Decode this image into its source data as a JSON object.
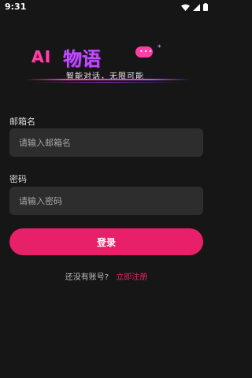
{
  "status_bar": {
    "time": "9:31"
  },
  "logo": {
    "ai_text": "AI",
    "name_text": "物语",
    "bubble_dots": "•••",
    "star": "*",
    "slogan": "智能对话，无限可能",
    "colors": {
      "pink": "#ff3fa6",
      "purple": "#c24bff"
    }
  },
  "form": {
    "email_label": "邮箱名",
    "email_placeholder": "请输入邮箱名",
    "email_value": "",
    "password_label": "密码",
    "password_placeholder": "请输入密码",
    "password_value": "",
    "login_label": "登录"
  },
  "register": {
    "prompt": "还没有账号?",
    "link_label": "立即注册"
  },
  "colors": {
    "background": "#161616",
    "input_bg": "#2d2d2d",
    "accent": "#e8206a"
  }
}
